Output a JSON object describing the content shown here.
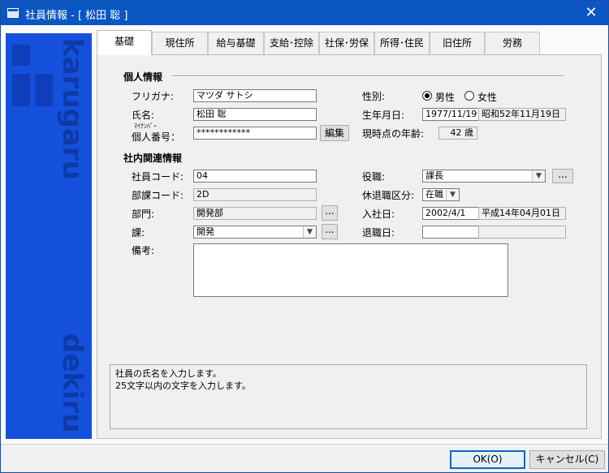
{
  "window": {
    "title": "社員情報 - [ 松田 聡 ]",
    "close_glyph": "✕"
  },
  "sidebar": {
    "brand_top": "karugaru",
    "brand_bottom": "dekiru"
  },
  "tabs": [
    "基礎",
    "現住所",
    "給与基礎",
    "支給･控除",
    "社保･労保",
    "所得･住民",
    "旧住所",
    "労務"
  ],
  "active_tab": "基礎",
  "personal": {
    "section_title": "個人情報",
    "furigana_label": "フリガナ:",
    "furigana_value": "マツダ サトシ",
    "name_label": "氏名:",
    "name_value": "松田 聡",
    "mynumber_ruby": "ﾏｲﾅﾝﾊﾞｰ",
    "mynumber_label": "個人番号：",
    "mynumber_value": "************",
    "edit_button": "編集",
    "gender_label": "性別:",
    "gender_male": "男性",
    "gender_female": "女性",
    "gender_selected": "male",
    "birth_label": "生年月日:",
    "birth_value": "1977/11/19",
    "birth_wareki": "昭和52年11月19日",
    "age_label": "現時点の年齢:",
    "age_value": "42 歳"
  },
  "company": {
    "section_title": "社内関連情報",
    "emp_code_label": "社員コード:",
    "emp_code_value": "04",
    "dept_code_label": "部課コード:",
    "dept_code_value": "2D",
    "dept_label": "部門:",
    "dept_value": "開発部",
    "section_label": "課:",
    "section_value": "開発",
    "remarks_label": "備考:",
    "position_label": "役職:",
    "position_value": "課長",
    "leave_label": "休退職区分:",
    "leave_value": "在職",
    "join_label": "入社日:",
    "join_value": "2002/4/1",
    "join_wareki": "平成14年04月01日",
    "retire_label": "退職日:",
    "retire_value": "",
    "retire_wareki": "",
    "browse_glyph": "..."
  },
  "help_text": {
    "line1": "社員の氏名を入力します。",
    "line2": "25文字以内の文字を入力します。"
  },
  "buttons": {
    "ok": "OK(O)",
    "cancel": "キャンセル(C)"
  }
}
